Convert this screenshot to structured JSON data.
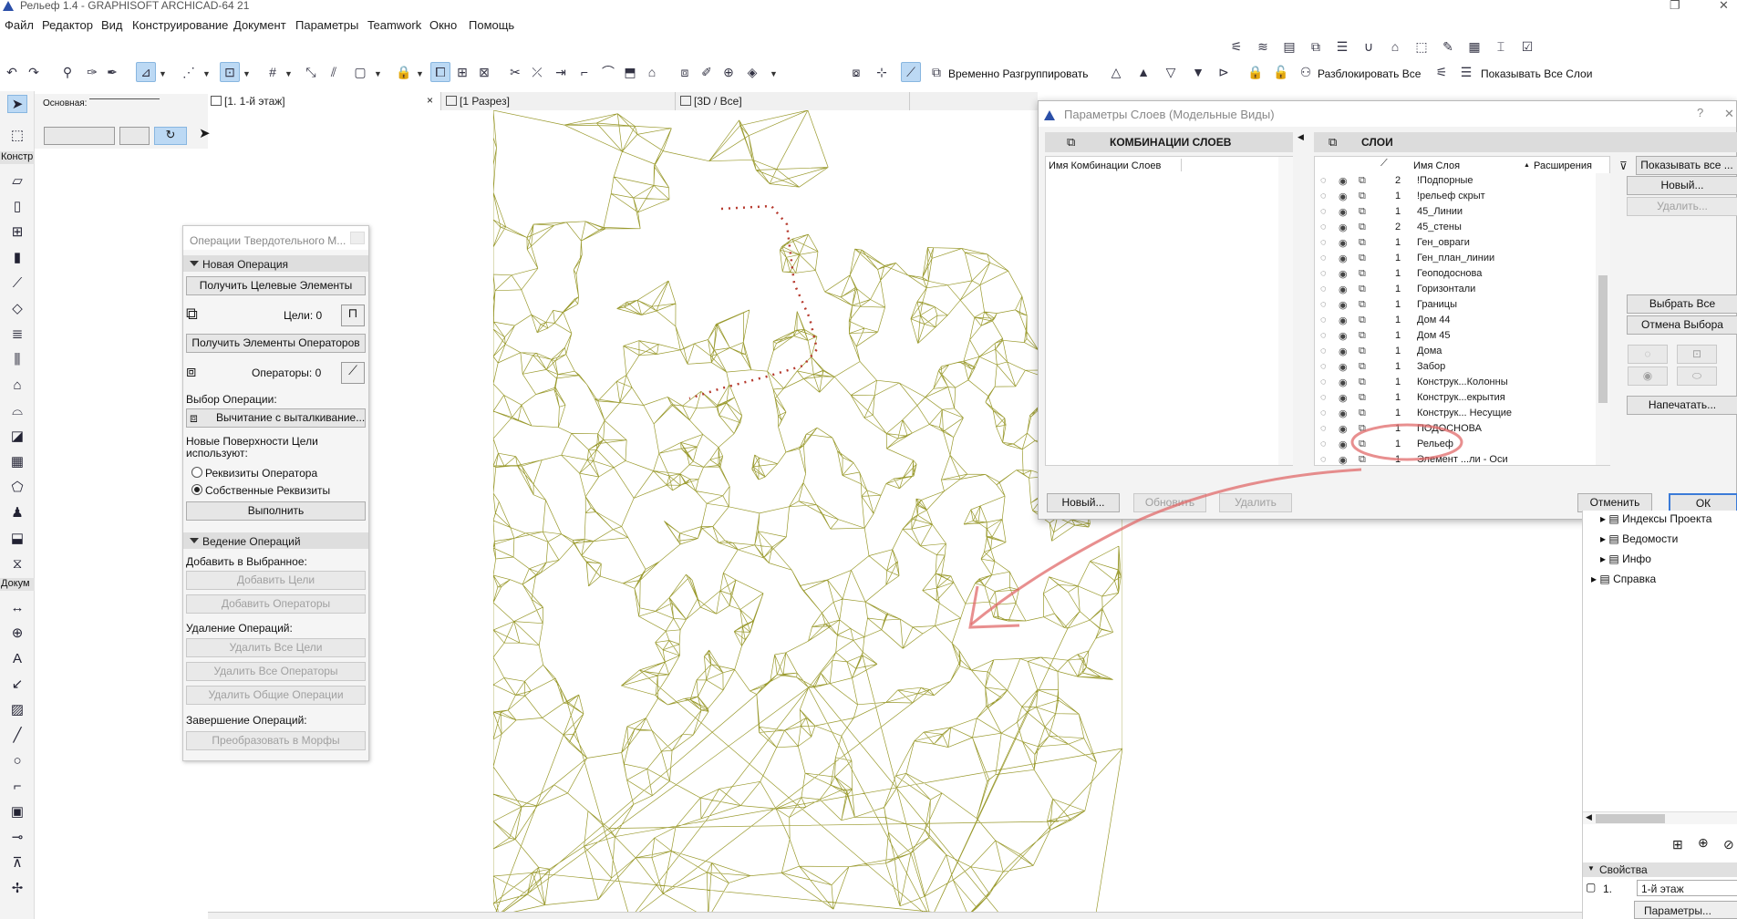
{
  "window": {
    "title": "Рельеф 1.4 - GRAPHISOFT ARCHICAD-64 21"
  },
  "menu": [
    "Файл",
    "Редактор",
    "Вид",
    "Конструирование",
    "Документ",
    "Параметры",
    "Teamwork",
    "Окно",
    "Помощь"
  ],
  "toolbar": {
    "ungroup_label": "Временно Разгруппировать",
    "unlock_all_label": "Разблокировать Все",
    "show_all_layers_label": "Показывать Все Слои"
  },
  "infobox": {
    "label": "Основная:"
  },
  "left_sections": {
    "design": "Констр",
    "document": "Докум"
  },
  "tabs": [
    {
      "label": "[1. 1-й этаж]",
      "close": "×"
    },
    {
      "label": "[1 Разрез]"
    },
    {
      "label": "[3D / Все]"
    }
  ],
  "solid_ops": {
    "title": "Операции Твердотельного М...",
    "section_new": "Новая Операция",
    "get_targets": "Получить Целевые Элементы",
    "targets_label": "Цели: 0",
    "get_operators": "Получить Элементы Операторов",
    "operators_label": "Операторы: 0",
    "choose_op_label": "Выбор Операции:",
    "op_value": "Вычитание с выталкивание...",
    "new_surfaces_label": "Новые Поверхности Цели используют:",
    "radio_operator": "Реквизиты Оператора",
    "radio_own": "Собственные Реквизиты",
    "execute": "Выполнить",
    "section_manage": "Ведение Операций",
    "add_selected_label": "Добавить в Выбранное:",
    "add_targets": "Добавить Цели",
    "add_operators": "Добавить Операторы",
    "remove_ops_label": "Удаление Операций:",
    "remove_all_targets": "Удалить Все Цели",
    "remove_all_operators": "Удалить Все Операторы",
    "remove_common": "Удалить Общие Операции",
    "finish_label": "Завершение Операций:",
    "convert_morph": "Преобразовать в Морфы"
  },
  "layer_dialog": {
    "title": "Параметры Слоев (Модельные Виды)",
    "help": "?",
    "combos_header": "КОМБИНАЦИИ СЛОЕВ",
    "combos_column": "Имя Комбинации Слоев",
    "layers_header": "СЛОИ",
    "col_name": "Имя Слоя",
    "col_ext": "Расширения",
    "btn_new_combo": "Новый...",
    "btn_update": "Обновить",
    "btn_delete_combo": "Удалить",
    "btn_show_all": "Показывать все ...",
    "btn_new_layer": "Новый...",
    "btn_delete_layer": "Удалить...",
    "btn_select_all": "Выбрать Все",
    "btn_deselect": "Отмена Выбора",
    "btn_print": "Напечатать...",
    "btn_cancel": "Отменить",
    "btn_ok": "ОК",
    "layers": [
      {
        "n": "2",
        "name": "!Подпорные"
      },
      {
        "n": "1",
        "name": "!рельеф скрыт"
      },
      {
        "n": "1",
        "name": "45_Линии"
      },
      {
        "n": "2",
        "name": "45_стены"
      },
      {
        "n": "1",
        "name": "Ген_овраги"
      },
      {
        "n": "1",
        "name": "Ген_план_линии"
      },
      {
        "n": "1",
        "name": "Геоподоснова"
      },
      {
        "n": "1",
        "name": "Горизонтали"
      },
      {
        "n": "1",
        "name": "Границы"
      },
      {
        "n": "1",
        "name": "Дом 44"
      },
      {
        "n": "1",
        "name": "Дом 45"
      },
      {
        "n": "1",
        "name": "Дома"
      },
      {
        "n": "1",
        "name": "Забор"
      },
      {
        "n": "1",
        "name": "Конструк...Колонны"
      },
      {
        "n": "1",
        "name": "Конструк...екрытия"
      },
      {
        "n": "1",
        "name": "Конструк... Несущие"
      },
      {
        "n": "1",
        "name": "ПОДОСНОВА"
      },
      {
        "n": "1",
        "name": "Рельеф"
      },
      {
        "n": "1",
        "name": "Элемент ...ли - Оси"
      }
    ]
  },
  "navigator": {
    "items": [
      "Индексы Проекта",
      "Ведомости",
      "Инфо",
      "Справка"
    ],
    "props_header": "Свойства",
    "story_num": "1.",
    "story_name": "1-й этаж",
    "params_btn": "Параметры..."
  },
  "colors": {
    "mesh": "#9a9a2e",
    "annotation": "#e06a6a",
    "active_tool": "#bcd9f4"
  }
}
